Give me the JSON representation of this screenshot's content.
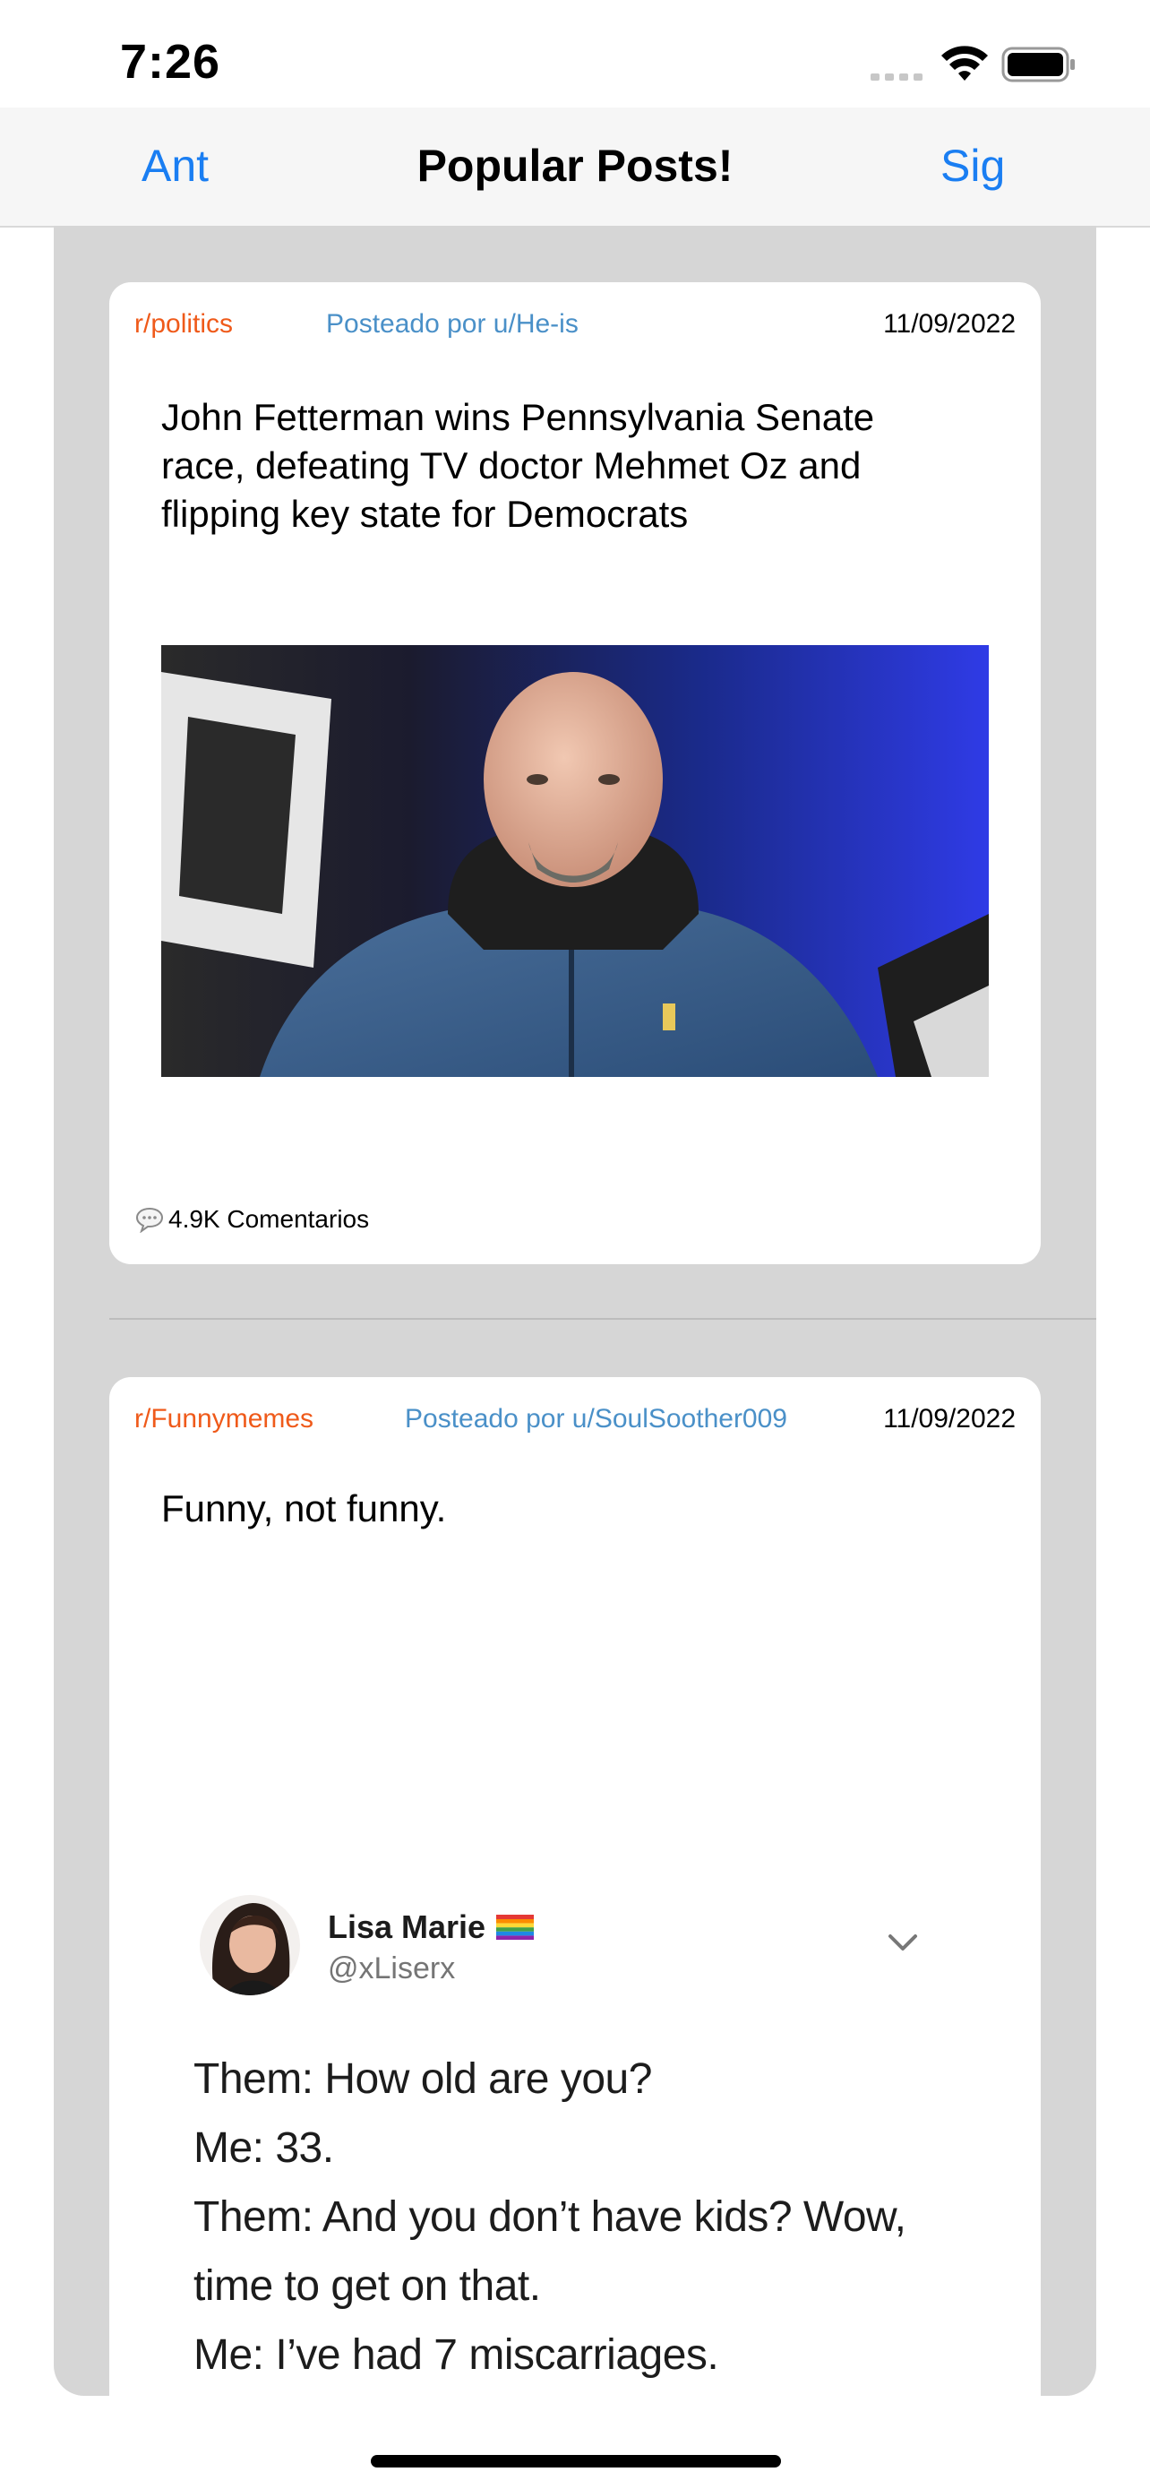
{
  "status_bar": {
    "time": "7:26"
  },
  "nav": {
    "left_label": "Ant",
    "title": "Popular Posts!",
    "right_label": "Sig"
  },
  "posts": [
    {
      "subreddit": "r/politics",
      "posted_by": "Posteado por u/He-is",
      "date": "11/09/2022",
      "title": "John Fetterman wins Pennsylvania Senate race, defeating TV doctor Mehmet Oz and flipping key state for Democrats",
      "comments": "4.9K Comentarios"
    },
    {
      "subreddit": "r/Funnymemes",
      "posted_by": "Posteado por u/SoulSoother009",
      "date": "11/09/2022",
      "title": "Funny, not funny.",
      "tweet": {
        "name": "Lisa Marie",
        "handle": "@xLiserx",
        "lines": [
          "Them: How old are you?",
          "Me: 33.",
          "Them: And you don’t have kids? Wow,",
          "time to get on that.",
          "Me: I’ve had 7 miscarriages."
        ]
      }
    }
  ],
  "colors": {
    "accent": "#1a7ef2",
    "subreddit": "#ef5a1a",
    "author": "#4a90c8",
    "feed_bg": "#d6d6d6"
  },
  "icons": {
    "comment": "speech-bubble-icon",
    "wifi": "wifi-icon",
    "battery": "battery-icon",
    "chevron": "chevron-down-icon"
  }
}
